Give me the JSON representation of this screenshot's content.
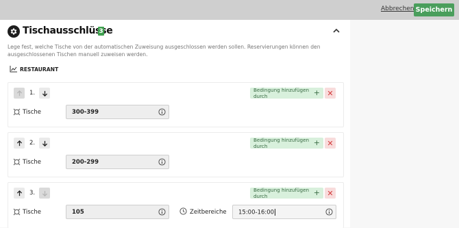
{
  "topbar": {
    "cancel_label": "Abbrechen",
    "save_label": "Speichern"
  },
  "section": {
    "title": "Tischausschlüsse",
    "count": "3",
    "description": "Lege fest, welche Tische von der automatischen Zuweisung ausgeschlossen werden sollen. Reservierungen können den ausgeschlossenen Tischen manuell zuweisen werden.",
    "group_label": "RESTAURANT",
    "icons": [
      "gear-icon",
      "chevron-up-icon",
      "chart-icon"
    ]
  },
  "rules": [
    {
      "number": "1.",
      "add_condition_label": "Bedingung hinzufügen durch",
      "tables_label": "Tische",
      "tables_value": "300-399"
    },
    {
      "number": "2.",
      "add_condition_label": "Bedingung hinzufügen durch",
      "tables_label": "Tische",
      "tables_value": "200-299"
    },
    {
      "number": "3.",
      "add_condition_label": "Bedingung hinzufügen durch",
      "tables_label": "Tische",
      "tables_value": "105",
      "time_label": "Zeitbereiche",
      "time_value": "15:00-16:00"
    }
  ],
  "colors": {
    "save": "#4a9e5c",
    "badge": "#3fa04f",
    "add_condition_bg": "#d8f0dc",
    "delete_bg": "#f8dcdc",
    "delete_fg": "#d23a3a"
  }
}
